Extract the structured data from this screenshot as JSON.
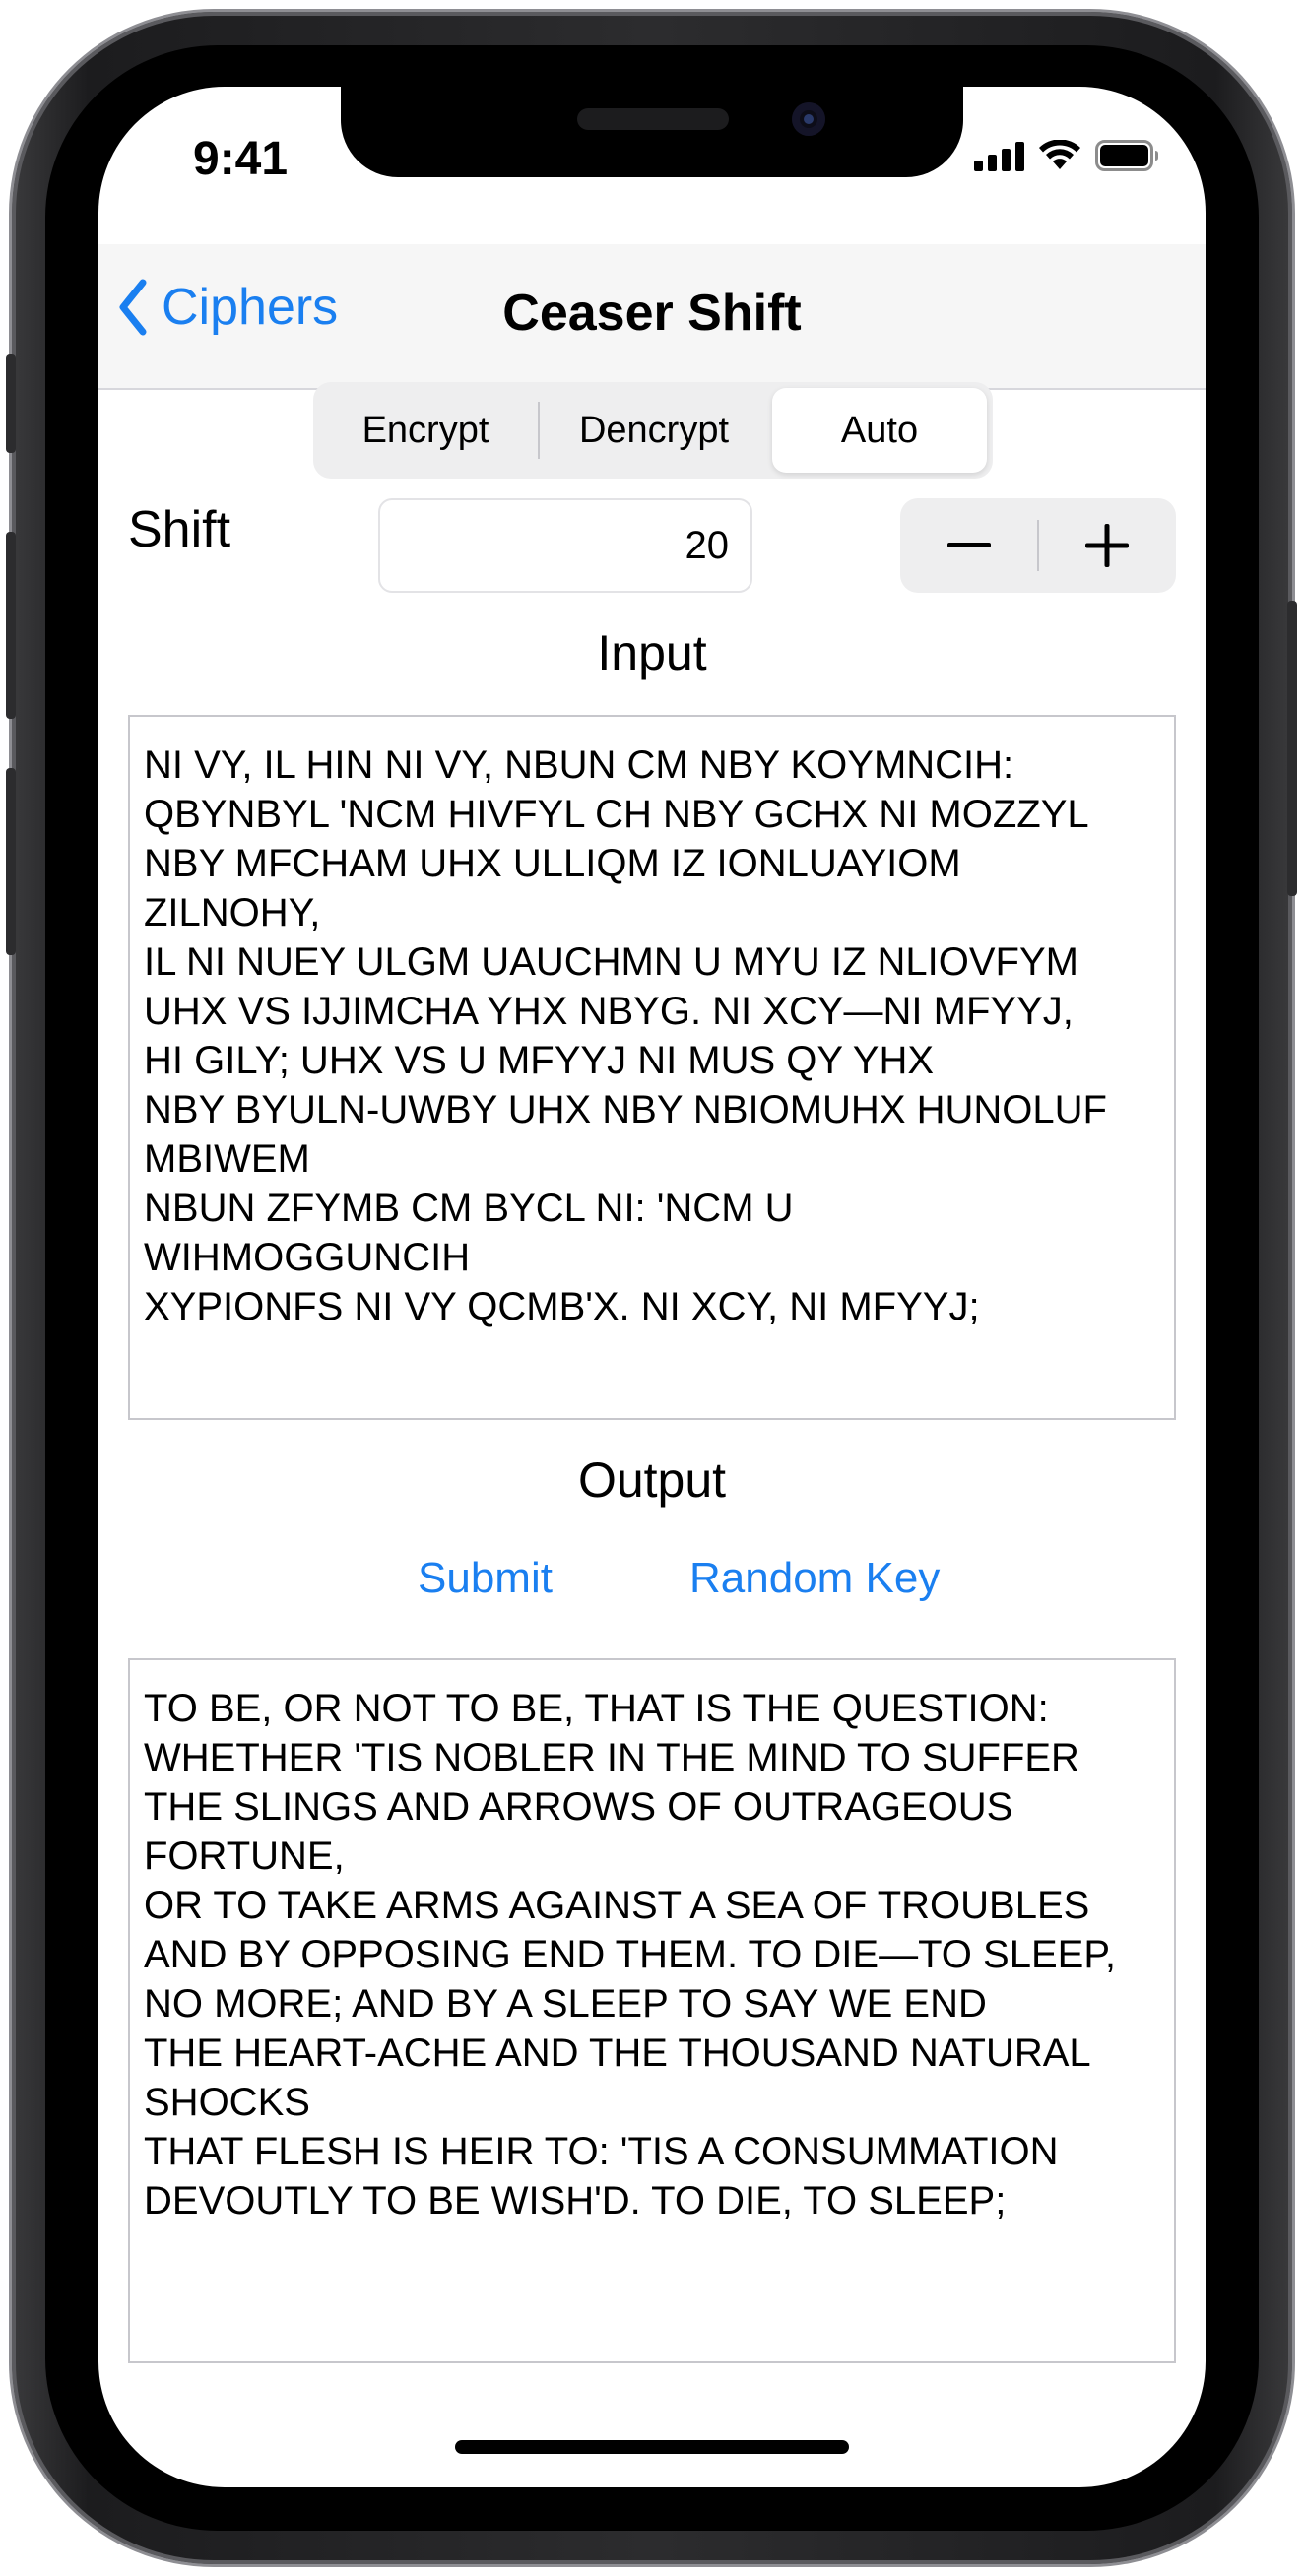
{
  "status_bar": {
    "time": "9:41"
  },
  "nav": {
    "back_label": "Ciphers",
    "title": "Ceaser Shift"
  },
  "segmented": {
    "options": [
      "Encrypt",
      "Dencrypt",
      "Auto"
    ],
    "selected": "Auto"
  },
  "shift": {
    "label": "Shift",
    "value": "20",
    "decrement": "−",
    "increment": "+"
  },
  "input": {
    "label": "Input",
    "text": "NI VY, IL HIN NI VY, NBUN CM NBY KOYMNCIH:\nQBYNBYL 'NCM HIVFYL CH NBY GCHX NI MOZZYL\nNBY MFCHAM UHX ULLIQM IZ IONLUAYIOM\nZILNOHY,\nIL NI NUEY ULGM UAUCHMN U MYU IZ NLIOVFYM\nUHX VS IJJIMCHA YHX NBYG. NI XCY—NI MFYYJ,\nHI GILY; UHX VS U MFYYJ NI MUS QY YHX\nNBY BYULN-UWBY UHX NBY NBIOMUHX HUNOLUF\nMBIWEM\nNBUN ZFYMB CM BYCL NI: 'NCM U\nWIHMOGGUNCIH\nXYPIONFS NI VY QCMB'X. NI XCY, NI MFYYJ;"
  },
  "output": {
    "label": "Output",
    "submit_label": "Submit",
    "random_key_label": "Random Key",
    "text": "TO BE, OR NOT TO BE, THAT IS THE QUESTION:\nWHETHER 'TIS NOBLER IN THE MIND TO SUFFER\nTHE SLINGS AND ARROWS OF OUTRAGEOUS\nFORTUNE,\nOR TO TAKE ARMS AGAINST A SEA OF TROUBLES\nAND BY OPPOSING END THEM. TO DIE—TO SLEEP,\nNO MORE; AND BY A SLEEP TO SAY WE END\nTHE HEART-ACHE AND THE THOUSAND NATURAL\nSHOCKS\nTHAT FLESH IS HEIR TO: 'TIS A CONSUMMATION\nDEVOUTLY TO BE WISH'D. TO DIE, TO SLEEP;"
  },
  "colors": {
    "accent": "#1a7ff0",
    "navbar_bg": "#f6f6f6",
    "segment_bg": "#eeeeef"
  },
  "icons": [
    "chevron-left-icon",
    "signal-icon",
    "wifi-icon",
    "battery-icon",
    "minus-icon",
    "plus-icon"
  ]
}
